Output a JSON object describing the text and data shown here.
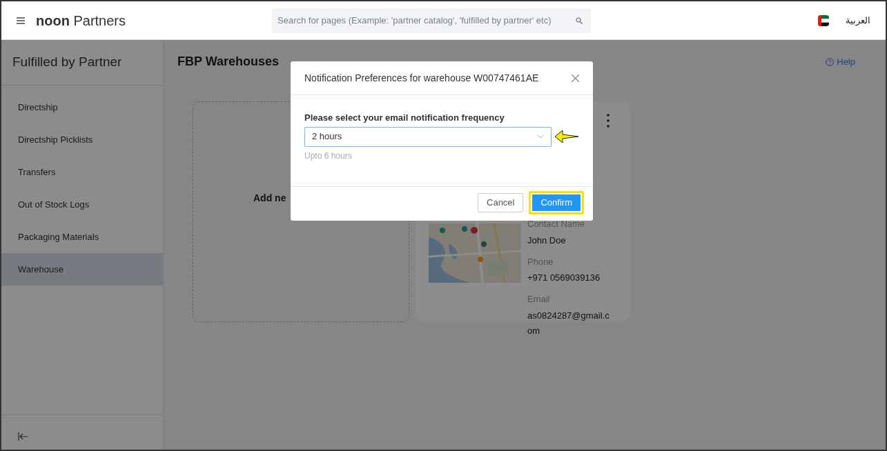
{
  "header": {
    "logo_bold": "noon",
    "logo_text": "Partners",
    "search": {
      "placeholder": "Search for pages (Example: 'partner catalog', 'fulfilled by partner' etc)"
    },
    "language": "العربية"
  },
  "sidebar": {
    "title": "Fulfilled by Partner",
    "items": [
      {
        "label": "Directship",
        "selected": false
      },
      {
        "label": "Directship Picklists",
        "selected": false
      },
      {
        "label": "Transfers",
        "selected": false
      },
      {
        "label": "Out of Stock Logs",
        "selected": false
      },
      {
        "label": "Packaging Materials",
        "selected": false
      },
      {
        "label": "Warehouse",
        "selected": true
      }
    ]
  },
  "page": {
    "title": "FBP Warehouses",
    "help": "Help"
  },
  "add_card": {
    "label": "Add ne"
  },
  "warehouse_card": {
    "fields": [
      {
        "label": "Contact Name",
        "value": "John Doe"
      },
      {
        "label": "Phone",
        "value": "+971 0569039136"
      },
      {
        "label": "Email",
        "value": "as0824287@gmail.com"
      }
    ]
  },
  "modal": {
    "title": "Notification Preferences for warehouse W00747461AE",
    "label": "Please select your email notification frequency",
    "select": {
      "value": "2 hours"
    },
    "hint": "Upto 6 hours",
    "buttons": [
      {
        "label": "Cancel",
        "kind": "secondary",
        "highlighted": false
      },
      {
        "label": "Confirm",
        "kind": "primary",
        "highlighted": true
      }
    ]
  }
}
